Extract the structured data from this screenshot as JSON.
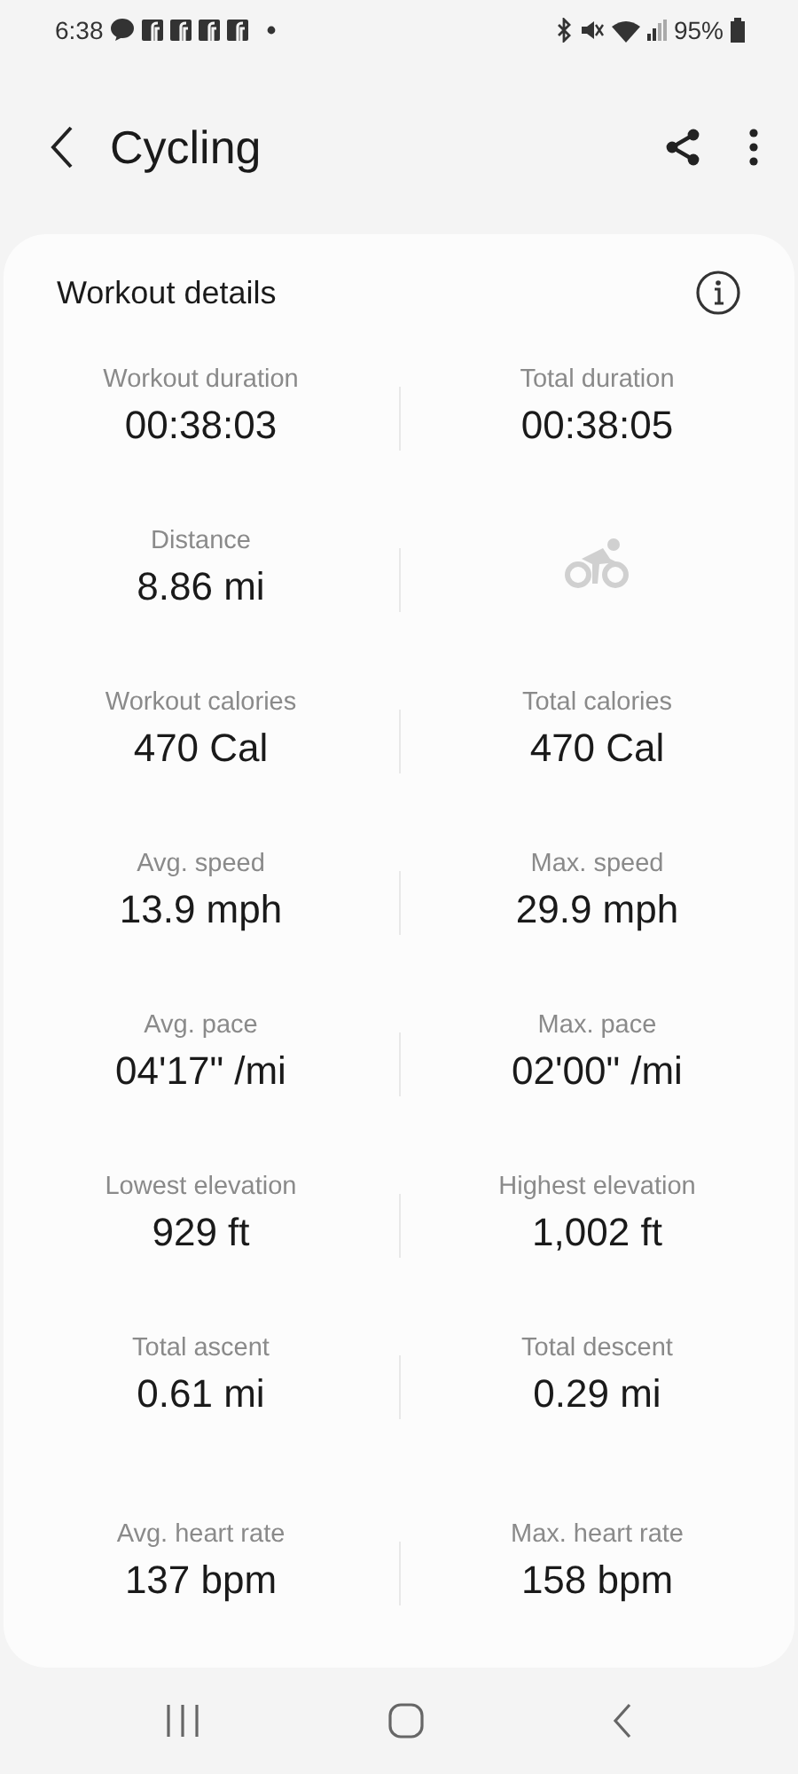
{
  "status_bar": {
    "time": "6:38",
    "battery": "95%"
  },
  "header": {
    "title": "Cycling"
  },
  "card": {
    "title": "Workout details",
    "rows": [
      [
        {
          "kind": "stat",
          "label": "Workout duration",
          "value": "00:38:03"
        },
        {
          "kind": "stat",
          "label": "Total duration",
          "value": "00:38:05"
        }
      ],
      [
        {
          "kind": "stat",
          "label": "Distance",
          "value": "8.86 mi"
        },
        {
          "kind": "icon"
        }
      ],
      [
        {
          "kind": "stat",
          "label": "Workout calories",
          "value": "470 Cal"
        },
        {
          "kind": "stat",
          "label": "Total calories",
          "value": "470 Cal"
        }
      ],
      [
        {
          "kind": "stat",
          "label": "Avg. speed",
          "value": "13.9 mph"
        },
        {
          "kind": "stat",
          "label": "Max. speed",
          "value": "29.9 mph"
        }
      ],
      [
        {
          "kind": "stat",
          "label": "Avg. pace",
          "value": "04'17\" /mi"
        },
        {
          "kind": "stat",
          "label": "Max. pace",
          "value": "02'00\" /mi"
        }
      ],
      [
        {
          "kind": "stat",
          "label": "Lowest elevation",
          "value": "929 ft"
        },
        {
          "kind": "stat",
          "label": "Highest elevation",
          "value": "1,002 ft"
        }
      ],
      [
        {
          "kind": "stat",
          "label": "Total ascent",
          "value": "0.61 mi"
        },
        {
          "kind": "stat",
          "label": "Total descent",
          "value": "0.29 mi"
        }
      ],
      [
        {
          "kind": "stat",
          "label": "Avg. heart rate",
          "value": "137 bpm"
        },
        {
          "kind": "stat",
          "label": "Max. heart rate",
          "value": "158 bpm"
        }
      ]
    ]
  }
}
